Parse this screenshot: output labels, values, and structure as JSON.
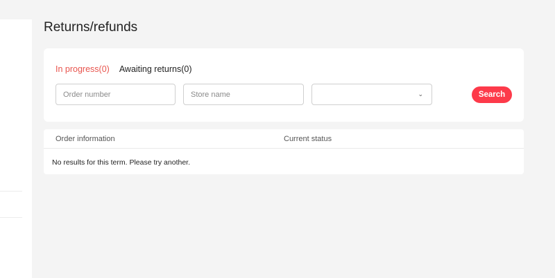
{
  "page": {
    "title": "Returns/refunds"
  },
  "tabs": [
    {
      "label": "In progress(0)",
      "active": true
    },
    {
      "label": "Awaiting returns(0)",
      "active": false
    }
  ],
  "filters": {
    "order_number_placeholder": "Order number",
    "order_number_value": "",
    "store_name_placeholder": "Store name",
    "store_name_value": "",
    "status_select_value": "",
    "search_label": "Search"
  },
  "results": {
    "columns": [
      "Order information",
      "Current status"
    ],
    "empty_message": "No results for this term. Please try another."
  },
  "colors": {
    "accent": "#e8554e",
    "search_button": "#fd3a4a",
    "background": "#f4f4f4"
  },
  "icons": {
    "select_chevron": "chevron-down-icon"
  }
}
